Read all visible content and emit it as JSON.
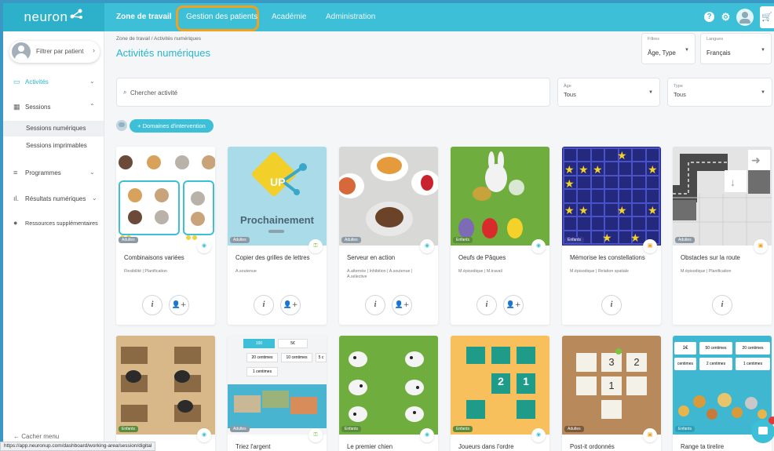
{
  "topbar": {
    "logo": "neuron",
    "nav": [
      {
        "label": "Zone de travail"
      },
      {
        "label": "Gestion des patients"
      },
      {
        "label": "Académie"
      },
      {
        "label": "Administration"
      }
    ],
    "help": "?",
    "gear": "⚙",
    "cart": "🛒",
    "accent": "#3dbfd7",
    "highlight": "#f3a01b"
  },
  "sidebar": {
    "patient_filter": "Filtrer par patient",
    "items": [
      {
        "label": "Activités"
      },
      {
        "label": "Sessions"
      },
      {
        "label": "Sessions numériques"
      },
      {
        "label": "Sessions imprimables"
      },
      {
        "label": "Programmes"
      },
      {
        "label": "Résultats numériques"
      },
      {
        "label": "Ressources supplémentaires"
      }
    ],
    "hide_menu": "Cacher menu"
  },
  "header": {
    "breadcrumb": "Zone de travail  /  Activités numériques",
    "title": "Activités numériques",
    "filters_label": "Filtres",
    "filters_value": "Âge, Type",
    "lang_label": "Langues",
    "lang_value": "Français"
  },
  "search": {
    "placeholder": "Chercher activité",
    "age_label": "Âge",
    "age_value": "Tous",
    "type_label": "Type",
    "type_value": "Tous"
  },
  "domains_button": "+ Domaines d'intervention",
  "upcoming_label": "Prochainement",
  "up_text": "UP",
  "cards": [
    {
      "title": "Combinaisons variées",
      "tags": "Flexibilité | Planification",
      "age": "Adultes"
    },
    {
      "title": "Copier des grilles de lettres",
      "tags": "A.soutenue",
      "age": "Adultes"
    },
    {
      "title": "Serveur en action",
      "tags": "A.alternée | Inhibition | A.soutenue | A.sélective",
      "age": "Adultes"
    },
    {
      "title": "Oeufs de Pâques",
      "tags": "M.épisodique | M.travail",
      "age": "Enfants"
    },
    {
      "title": "Mémorise les constellations",
      "tags": "M.épisodique | Relation spatiale",
      "age": "Enfants"
    },
    {
      "title": "Obstacles sur la route",
      "tags": "M.épisodique | Planification",
      "age": "Adultes"
    },
    {
      "title": "",
      "tags": "",
      "age": "Enfants"
    },
    {
      "title": "Triez l'argent",
      "tags": "",
      "age": "Adultes"
    },
    {
      "title": "Le premier chien",
      "tags": "",
      "age": "Enfants"
    },
    {
      "title": "Joueurs dans l'ordre",
      "tags": "",
      "age": "Enfants"
    },
    {
      "title": "Post-it ordonnés",
      "tags": "",
      "age": "Adultes"
    },
    {
      "title": "Range ta tirelire",
      "tags": "",
      "age": "Enfants"
    }
  ],
  "money_labels": [
    "100",
    "5€",
    "20 centimes",
    "10 centimes",
    "5 c",
    "1 centimes"
  ],
  "coin_labels": [
    "1€",
    "50 centimes",
    "20 centimes",
    "centimes",
    "2 centimes",
    "1 centimes"
  ],
  "post_numbers": [
    "3",
    "2",
    "1"
  ],
  "shirt_numbers": [
    "2",
    "1"
  ],
  "info_glyph": "i",
  "assign_glyph": "👤+",
  "status_url": "https://app.neuronup.com/dashboard/working-area/session/digital"
}
